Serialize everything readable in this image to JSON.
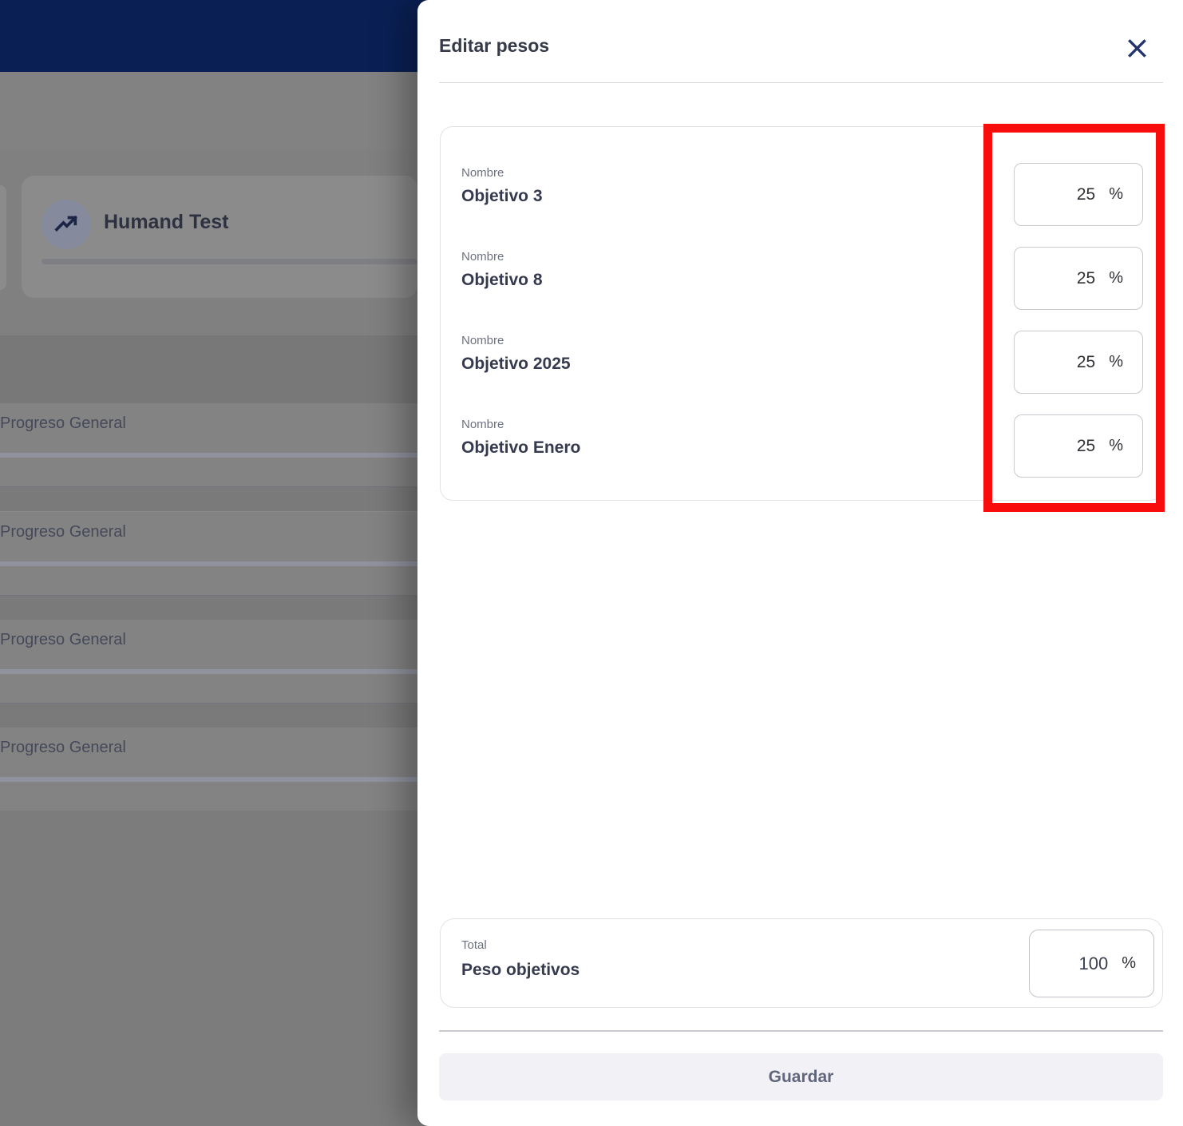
{
  "backdrop": {
    "goal_card": {
      "title": "Humand Test",
      "icon": "trending-up-icon"
    },
    "rows": [
      {
        "label": "Progreso General"
      },
      {
        "label": "Progreso General"
      },
      {
        "label": "Progreso General"
      },
      {
        "label": "Progreso General"
      }
    ]
  },
  "modal": {
    "title": "Editar pesos",
    "close_icon": "close-x",
    "weights_card": {
      "items": [
        {
          "field_label": "Nombre",
          "name": "Objetivo 3",
          "weight": "25",
          "unit": "%"
        },
        {
          "field_label": "Nombre",
          "name": "Objetivo 8",
          "weight": "25",
          "unit": "%"
        },
        {
          "field_label": "Nombre",
          "name": "Objetivo 2025",
          "weight": "25",
          "unit": "%"
        },
        {
          "field_label": "Nombre",
          "name": "Objetivo Enero",
          "weight": "25",
          "unit": "%"
        }
      ]
    },
    "total_card": {
      "field_label": "Total",
      "name": "Peso objetivos",
      "value": "100",
      "unit": "%"
    },
    "save_button": {
      "label": "Guardar"
    }
  },
  "annotation": {
    "type": "highlight-rectangle",
    "color": "#f90d0c"
  },
  "colors": {
    "navbar": "#0a2055",
    "accent_navy": "#24346e",
    "annotation_red": "#f90d0c",
    "save_button_bg": "#f1f1f6",
    "save_button_text": "#62667c"
  }
}
